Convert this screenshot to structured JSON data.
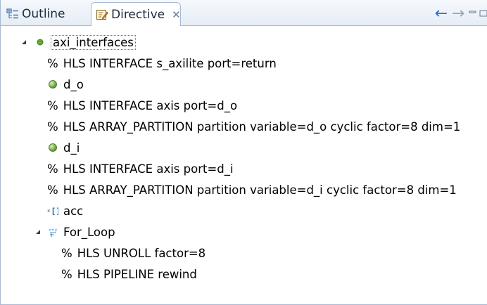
{
  "tabs": [
    {
      "label": "Outline",
      "icon": "outline-icon"
    },
    {
      "label": "Directive",
      "icon": "directive-icon",
      "close": "✕",
      "active": true
    }
  ],
  "toolbar": {
    "back_glyph": "←",
    "forward_glyph": "→",
    "minimize_glyph": "▭"
  },
  "tree": {
    "root": {
      "label": "axi_interfaces",
      "icon": "function-icon",
      "expanded": true
    },
    "items": [
      {
        "type": "directive",
        "prefix": "%",
        "label": "HLS INTERFACE s_axilite port=return"
      },
      {
        "type": "port",
        "icon": "port-icon",
        "label": "d_o"
      },
      {
        "type": "directive",
        "prefix": "%",
        "label": "HLS INTERFACE axis port=d_o"
      },
      {
        "type": "directive",
        "prefix": "%",
        "label": "HLS ARRAY_PARTITION partition variable=d_o cyclic factor=8 dim=1"
      },
      {
        "type": "port",
        "icon": "port-icon",
        "label": "d_i"
      },
      {
        "type": "directive",
        "prefix": "%",
        "label": "HLS INTERFACE axis port=d_i"
      },
      {
        "type": "directive",
        "prefix": "%",
        "label": "HLS ARRAY_PARTITION partition variable=d_i cyclic factor=8 dim=1"
      },
      {
        "type": "variable",
        "icon": "array-variable-icon",
        "label": "acc"
      },
      {
        "type": "loop",
        "icon": "loop-icon",
        "label": "For_Loop",
        "expanded": true
      },
      {
        "type": "directive",
        "prefix": "%",
        "label": "HLS UNROLL factor=8"
      },
      {
        "type": "directive",
        "prefix": "%",
        "label": "HLS PIPELINE rewind"
      }
    ]
  },
  "colors": {
    "accent": "#2f6fd1",
    "border": "#a9b8d2",
    "port_green": "#6aa83a",
    "loop_icon": "#4a90c8"
  }
}
